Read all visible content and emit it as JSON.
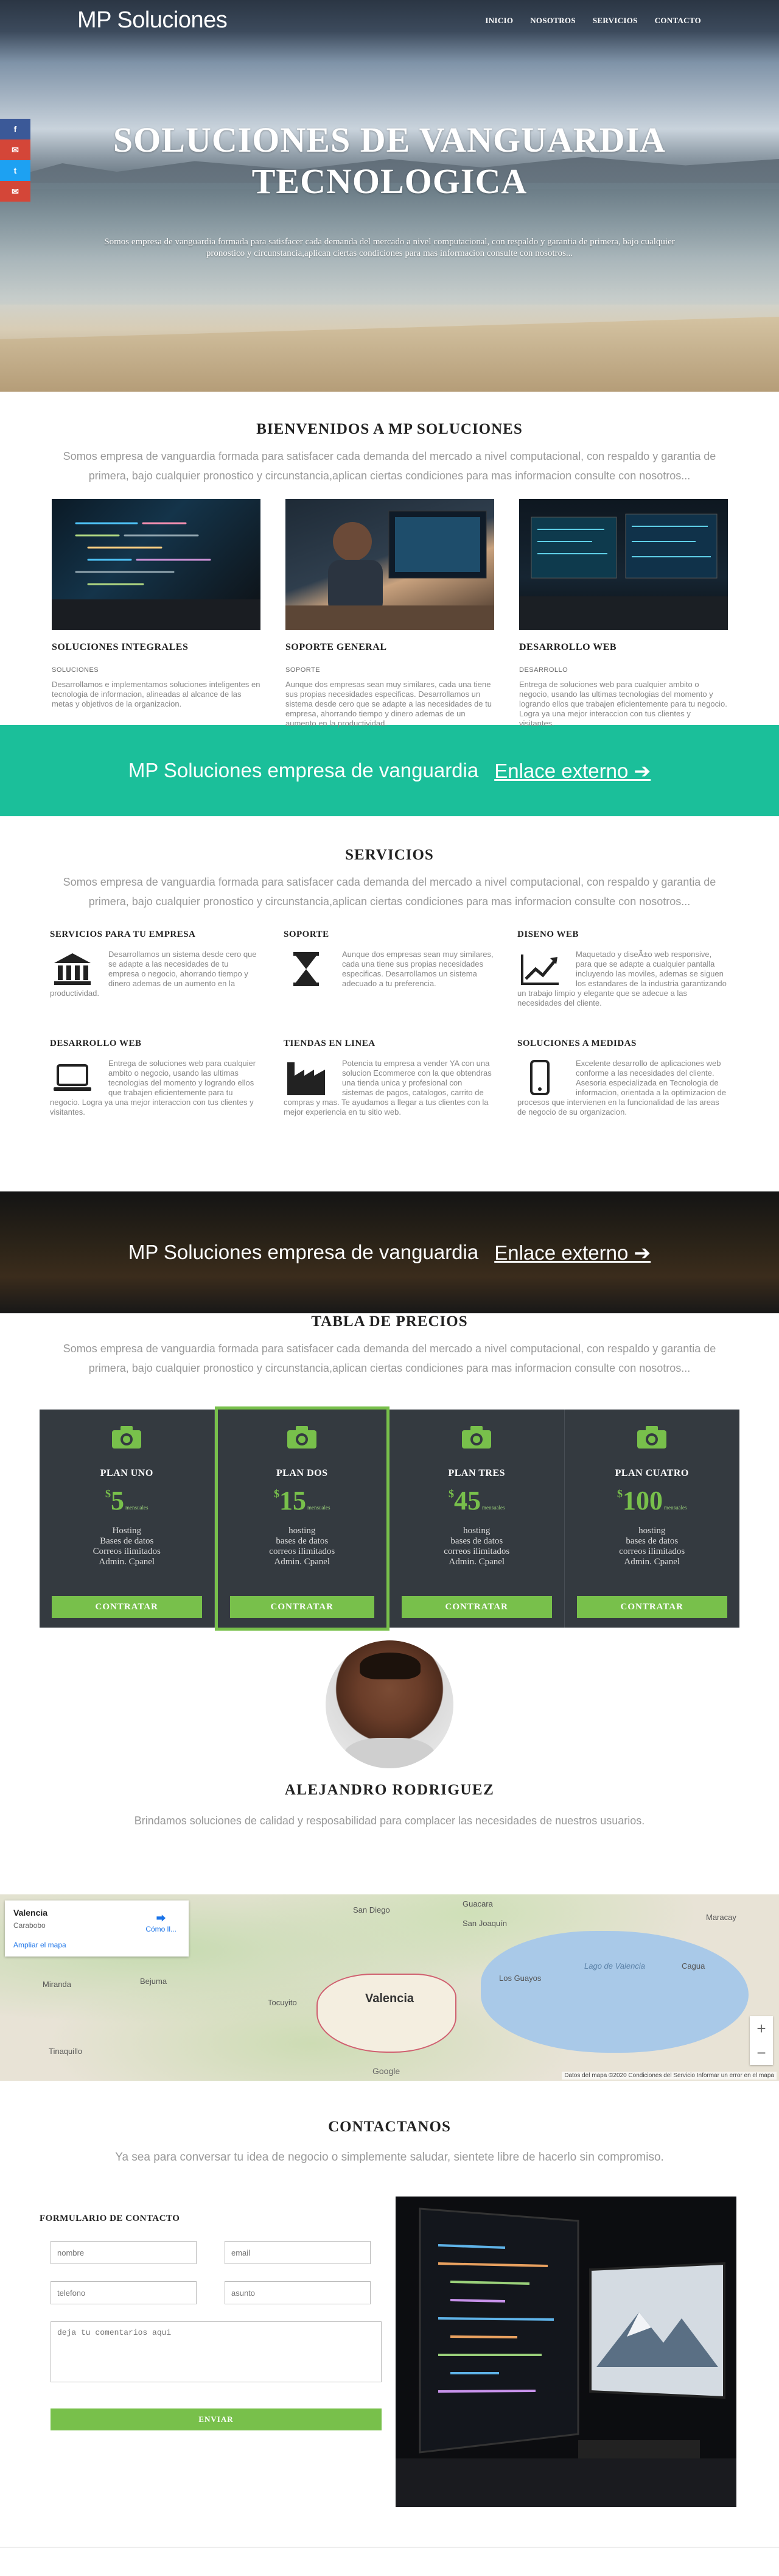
{
  "nav": {
    "brand": "MP Soluciones",
    "items": [
      "INICIO",
      "NOSOTROS",
      "SERVICIOS",
      "CONTACTO"
    ]
  },
  "social": [
    {
      "icon": "facebook-icon",
      "glyph": "f",
      "color": "#3b5998"
    },
    {
      "icon": "mail-icon",
      "glyph": "✉",
      "color": "#d44638"
    },
    {
      "icon": "twitter-icon",
      "glyph": "t",
      "color": "#1da1f2"
    },
    {
      "icon": "mail-icon",
      "glyph": "✉",
      "color": "#d44638"
    }
  ],
  "hero": {
    "title": "SOLUCIONES DE VANGUARDIA TECNOLOGICA",
    "text": "Somos empresa de vanguardia formada para satisfacer cada demanda del mercado a nivel computacional, con respaldo y garantia de primera, bajo cualquier pronostico y circunstancia,aplican ciertas condiciones para mas informacion consulte con nosotros..."
  },
  "welcome": {
    "title": "BIENVENIDOS A MP SOLUCIONES",
    "subtitle": "Somos empresa de vanguardia formada para satisfacer cada demanda del mercado a nivel computacional, con respaldo y garantia de primera, bajo cualquier pronostico y circunstancia,aplican ciertas condiciones para mas informacion consulte con nosotros...",
    "cards": [
      {
        "title": "SOLUCIONES INTEGRALES",
        "tag": "SOLUCIONES",
        "text": "Desarrollamos e implementamos soluciones inteligentes en tecnologia de informacion, alineadas al alcance de las metas y objetivos de la organizacion."
      },
      {
        "title": "SOPORTE GENERAL",
        "tag": "SOPORTE",
        "text": "Aunque dos empresas sean muy similares, cada una tiene sus propias necesidades especificas. Desarrollamos un sistema desde cero que se adapte a las necesidades de tu empresa, ahorrando tiempo y dinero ademas de un aumento en la productividad."
      },
      {
        "title": "DESARROLLO WEB",
        "tag": "DESARROLLO",
        "text": "Entrega de soluciones web para cualquier ambito o negocio, usando las ultimas tecnologias del momento y logrando ellos que trabajen eficientemente para tu negocio. Logra ya una mejor interaccion con tus clientes y visitantes."
      }
    ]
  },
  "band": {
    "text": "MP Soluciones empresa de vanguardia",
    "link": "Enlace externo ➔"
  },
  "services": {
    "title": "SERVICIOS",
    "subtitle": "Somos empresa de vanguardia formada para satisfacer cada demanda del mercado a nivel computacional, con respaldo y garantia de primera, bajo cualquier pronostico y circunstancia,aplican ciertas condiciones para mas informacion consulte con nosotros...",
    "items": [
      {
        "title": "SERVICIOS PARA TU EMPRESA",
        "icon": "bank-icon",
        "text": "Desarrollamos un sistema desde cero que se adapte a las necesidades de tu empresa o negocio, ahorrando tiempo y dinero ademas de un aumento en la productividad."
      },
      {
        "title": "SOPORTE",
        "icon": "hourglass-icon",
        "text": "Aunque dos empresas sean muy similares, cada una tiene sus propias necesidades especificas. Desarrollamos un sistema adecuado a tu preferencia."
      },
      {
        "title": "DISENO WEB",
        "icon": "chart-line-icon",
        "text": "Maquetado y diseÃ±o web responsive, para que se adapte a cualquier pantalla incluyendo las moviles, ademas se siguen los estandares de la industria garantizando un trabajo limpio y elegante que se adecue a las necesidades del cliente."
      },
      {
        "title": "DESARROLLO WEB",
        "icon": "laptop-icon",
        "text": "Entrega de soluciones web para cualquier ambito o negocio, usando las ultimas tecnologias del momento y logrando ellos que trabajen eficientemente para tu negocio. Logra ya una mejor interaccion con tus clientes y visitantes."
      },
      {
        "title": "TIENDAS EN LINEA",
        "icon": "factory-icon",
        "text": "Potencia tu empresa a vender YA con una solucion Ecommerce con la que obtendras una tienda unica y profesional con sistemas de pagos, catalogos, carrito de compras y mas. Te ayudamos a llegar a tus clientes con la mejor experiencia en tu sitio web."
      },
      {
        "title": "SOLUCIONES A MEDIDAS",
        "icon": "mobile-icon",
        "text": "Excelente desarrollo de aplicaciones web conforme a las necesidades del cliente. Asesoria especializada en Tecnologia de informacion, orientada a la optimizacion de procesos que intervienen en la funcionalidad de las areas de negocio de su organizacion."
      }
    ]
  },
  "pricing": {
    "title": "TABLA DE PRECIOS",
    "subtitle": "Somos empresa de vanguardia formada para satisfacer cada demanda del mercado a nivel computacional, con respaldo y garantia de primera, bajo cualquier pronostico y circunstancia,aplican ciertas condiciones para mas informacion consulte con nosotros...",
    "accent": "#78c04b",
    "plans": [
      {
        "name": "PLAN UNO",
        "currency": "$",
        "price": "5",
        "unit": "mensuales",
        "features": [
          "Hosting",
          "Bases de datos",
          "Correos ilimitados",
          "Admin. Cpanel"
        ],
        "button": "CONTRATAR"
      },
      {
        "name": "PLAN DOS",
        "currency": "$",
        "price": "15",
        "unit": "mensuales",
        "features": [
          "hosting",
          "bases de datos",
          "correos ilimitados",
          "Admin. Cpanel"
        ],
        "button": "CONTRATAR"
      },
      {
        "name": "PLAN TRES",
        "currency": "$",
        "price": "45",
        "unit": "mensuales",
        "features": [
          "hosting",
          "bases de datos",
          "correos ilimitados",
          "Admin. Cpanel"
        ],
        "button": "CONTRATAR"
      },
      {
        "name": "PLAN CUATRO",
        "currency": "$",
        "price": "100",
        "unit": "mensuales",
        "features": [
          "hosting",
          "bases de datos",
          "correos ilimitados",
          "Admin. Cpanel"
        ],
        "button": "CONTRATAR"
      }
    ]
  },
  "team": {
    "name": "ALEJANDRO RODRIGUEZ",
    "text": "Brindamos soluciones de calidad y resposabilidad para complacer las necesidades de nuestros usuarios."
  },
  "map": {
    "place": "Valencia",
    "region": "Carabobo",
    "directions": "Cómo ll...",
    "enlarge": "Ampliar el mapa",
    "city_label": "Valencia",
    "labels": [
      "San Diego",
      "Guacara",
      "San Joaquín",
      "Maracay",
      "Tocuyito",
      "Los Guayos",
      "Lago de Valencia",
      "Bejuma",
      "Miranda",
      "Tinaquillo",
      "Cagua"
    ],
    "attribution": "Datos del mapa ©2020   Condiciones del Servicio   Informar un error en el mapa",
    "google": "Google"
  },
  "contact": {
    "title": "CONTACTANOS",
    "subtitle": "Ya sea para conversar tu idea de negocio o simplemente saludar, sientete libre de hacerlo sin compromiso.",
    "form_title": "FORMULARIO DE CONTACTO",
    "name_ph": "nombre",
    "email_ph": "email",
    "phone_ph": "telefono",
    "subject_ph": "asunto",
    "message_ph": "deja tu comentarios aqui",
    "send": "ENVIAR"
  }
}
